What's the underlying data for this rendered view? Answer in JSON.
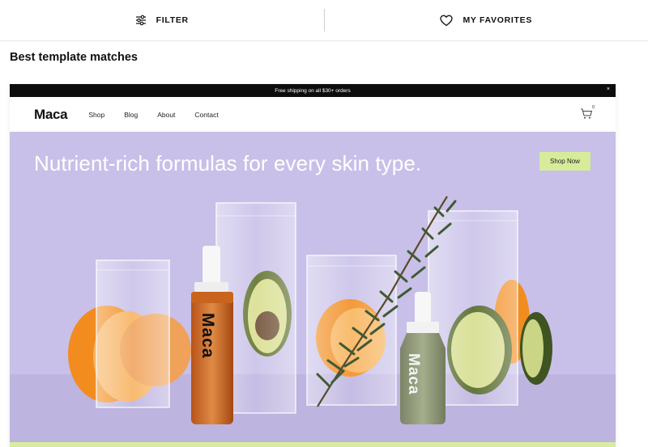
{
  "toolbar": {
    "filter_label": "FILTER",
    "favorites_label": "MY FAVORITES"
  },
  "section": {
    "title": "Best template matches"
  },
  "template": {
    "announcement": "Free shipping on all $30+ orders",
    "close_symbol": "×",
    "logo": "Maca",
    "nav": [
      "Shop",
      "Blog",
      "About",
      "Contact"
    ],
    "cart_count": "0",
    "hero_title": "Nutrient-rich formulas for every skin type.",
    "hero_button": "Shop Now",
    "bottle_brand": "Maca"
  },
  "colors": {
    "hero_bg": "#c8c0e8",
    "button_bg": "#d6ec9a",
    "announcement_bg": "#0d0d0d"
  }
}
